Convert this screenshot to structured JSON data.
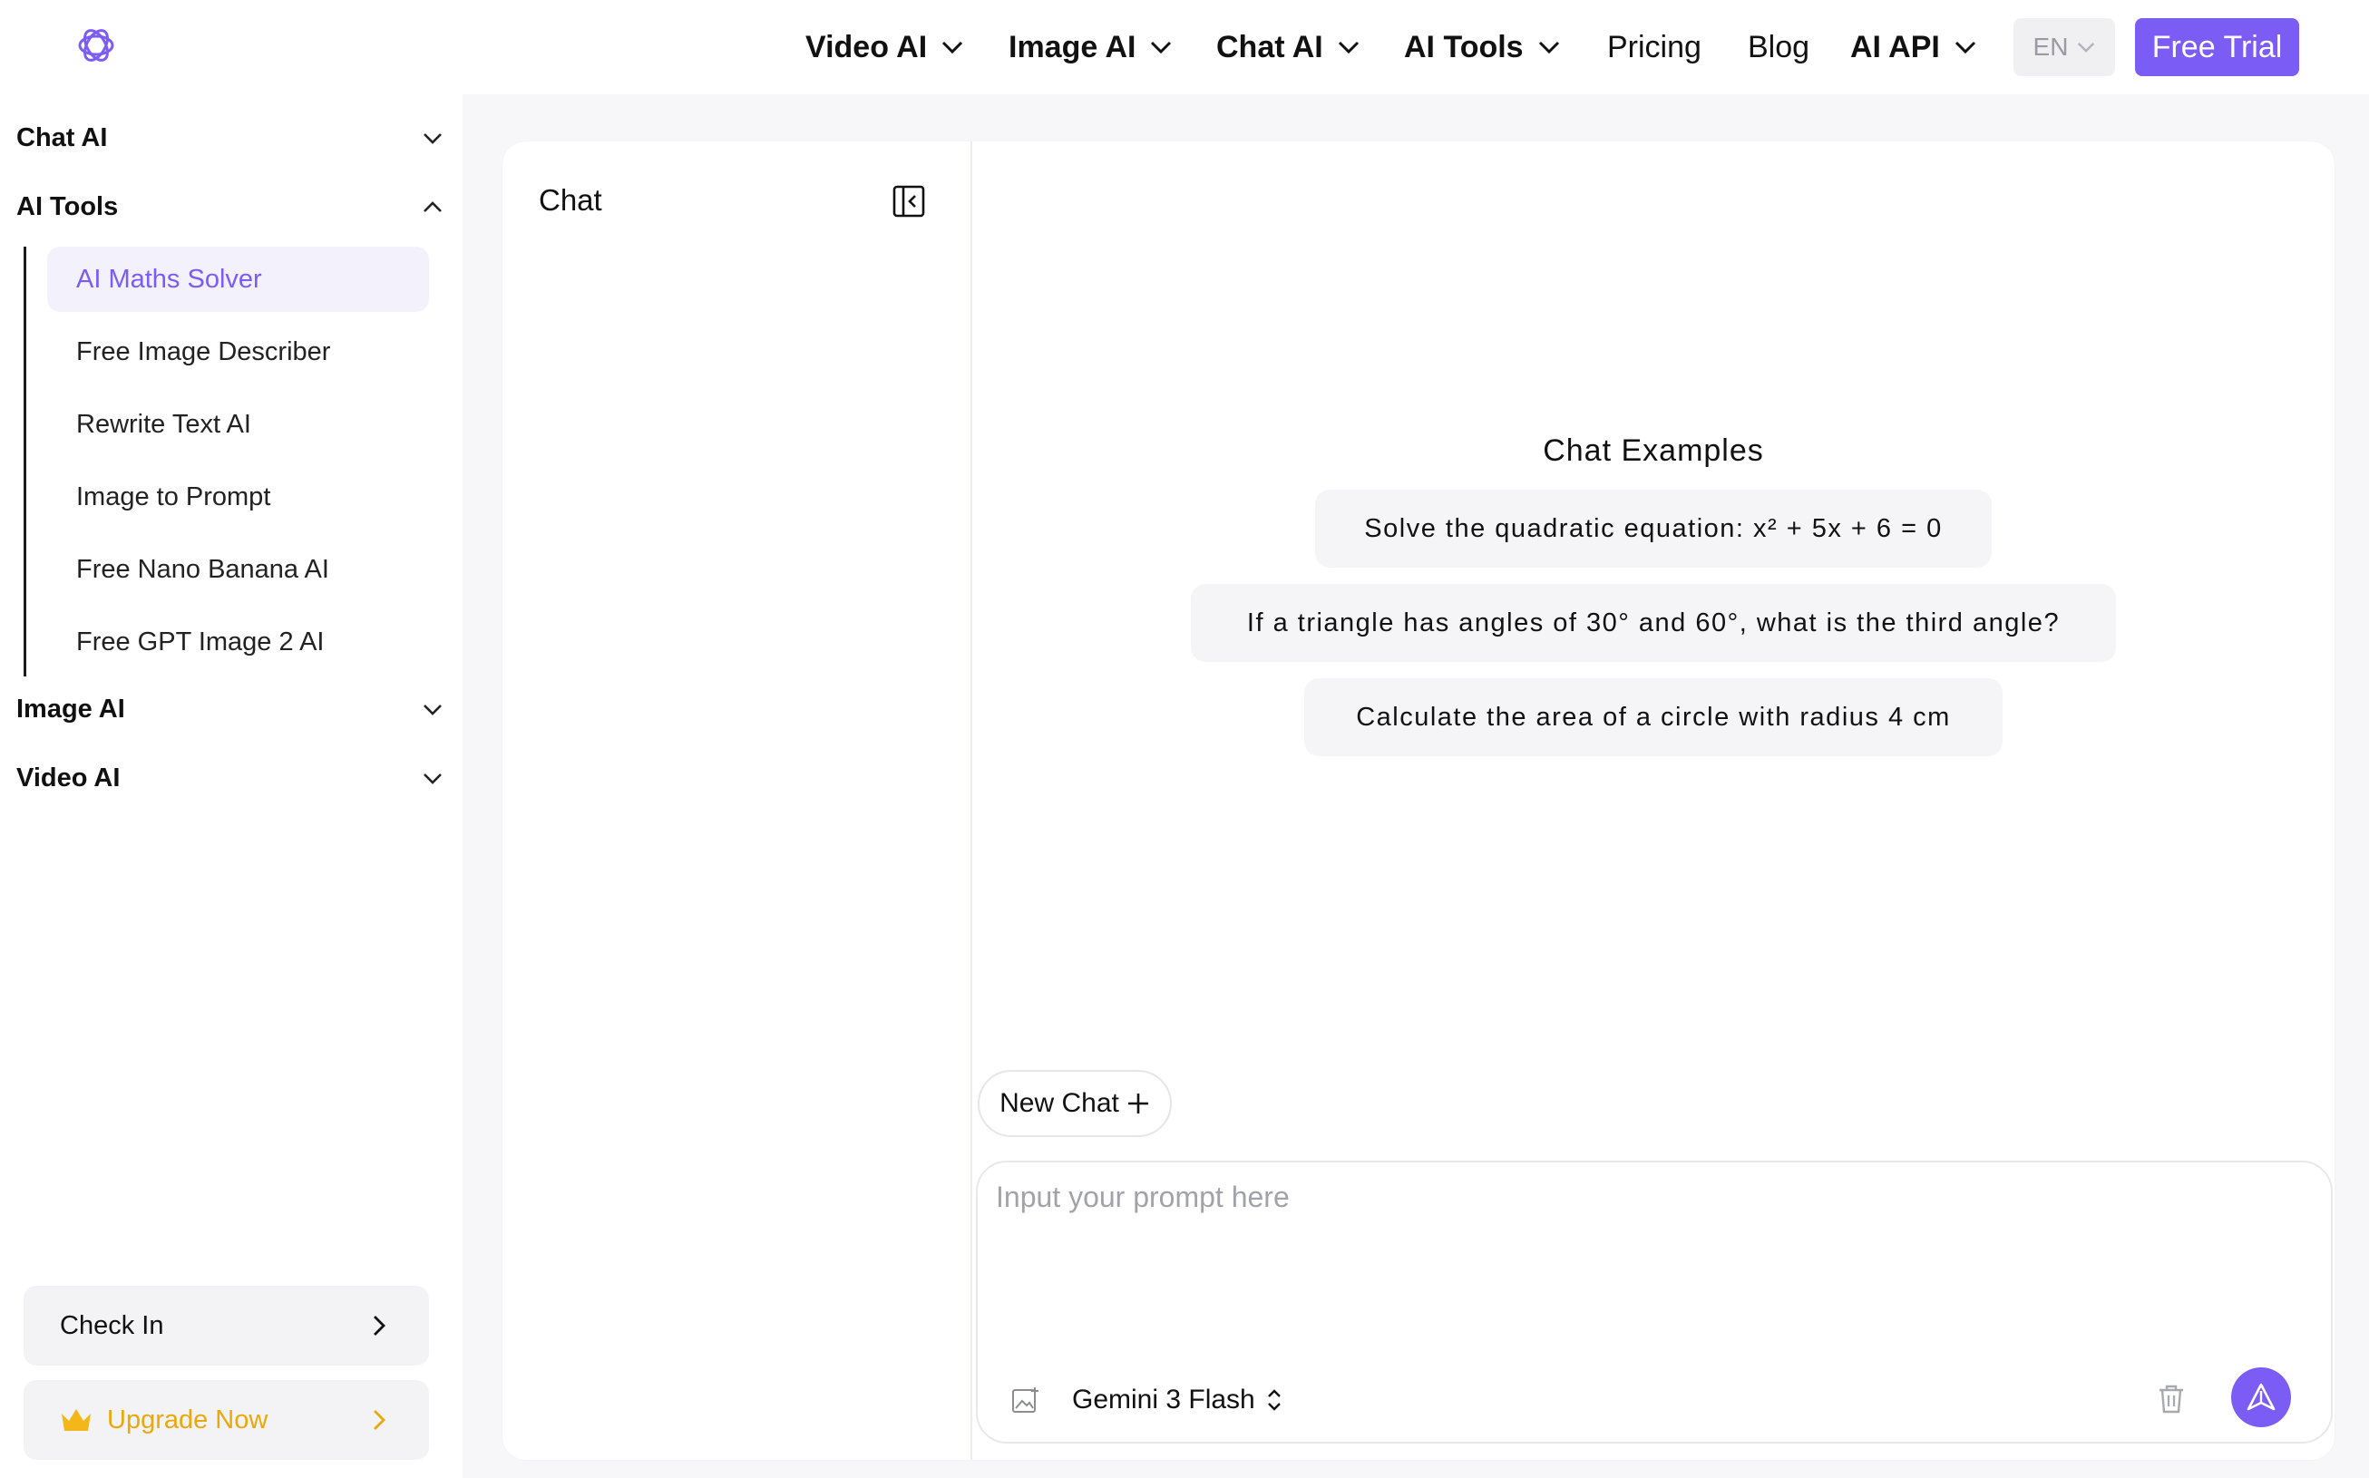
{
  "nav": {
    "items": [
      {
        "label": "Video AI",
        "dropdown": true
      },
      {
        "label": "Image AI",
        "dropdown": true
      },
      {
        "label": "Chat AI",
        "dropdown": true
      },
      {
        "label": "AI Tools",
        "dropdown": true
      },
      {
        "label": "Pricing",
        "dropdown": false
      },
      {
        "label": "Blog",
        "dropdown": false
      },
      {
        "label": "AI API",
        "dropdown": true
      }
    ],
    "language": "EN",
    "trial_label": "Free Trial"
  },
  "sidebar": {
    "groups": [
      {
        "label": "Chat AI",
        "expanded": false
      },
      {
        "label": "AI Tools",
        "expanded": true
      },
      {
        "label": "Image AI",
        "expanded": false
      },
      {
        "label": "Video AI",
        "expanded": false
      }
    ],
    "tools": [
      {
        "label": "AI Maths Solver",
        "active": true
      },
      {
        "label": "Free Image Describer",
        "active": false
      },
      {
        "label": "Rewrite Text AI",
        "active": false
      },
      {
        "label": "Image to Prompt",
        "active": false
      },
      {
        "label": "Free Nano Banana AI",
        "active": false
      },
      {
        "label": "Free GPT Image 2 AI",
        "active": false
      }
    ],
    "check_in_label": "Check In",
    "upgrade_label": "Upgrade Now"
  },
  "history": {
    "title": "Chat"
  },
  "chat": {
    "examples_title": "Chat Examples",
    "examples": [
      "Solve the quadratic equation: x² + 5x + 6 = 0",
      "If a triangle has angles of 30° and 60°, what is the third angle?",
      "Calculate the area of a circle with radius 4 cm"
    ],
    "new_chat_label": "New Chat",
    "prompt_placeholder": "Input your prompt here",
    "prompt_value": "",
    "model": "Gemini 3 Flash"
  },
  "colors": {
    "accent": "#7b5cf5",
    "upgrade": "#e9a90b",
    "active_bg": "#f3f1fb"
  }
}
